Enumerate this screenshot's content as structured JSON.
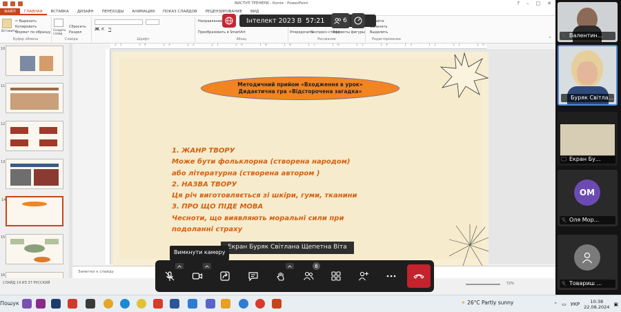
{
  "window": {
    "title": "ВИСТУП ТРЕНЕРИ - Копія - PowerPoint",
    "tabs": [
      "ФАЙЛ",
      "ГЛАВНАЯ",
      "ВСТАВКА",
      "ДИЗАЙН",
      "ПЕРЕХОДЫ",
      "АНИМАЦИЯ",
      "ПОКАЗ СЛАЙДОВ",
      "РЕЦЕНЗИРОВАНИЕ",
      "ВИД"
    ],
    "active_tab": "ГЛАВНАЯ",
    "accent": "#c8441a"
  },
  "ribbon": {
    "groups": [
      "Буфер обмена",
      "Слайды",
      "Шрифт",
      "Абзац",
      "Рисование",
      "Редактирование"
    ],
    "items": {
      "paste": "Вставить",
      "cut": "Вырезать",
      "copy": "Копировать",
      "format_painter": "Формат по образцу",
      "new_slide": "Создать слайд",
      "reset": "Сбросить",
      "section": "Раздел",
      "text_direction": "Направление текста",
      "smartart": "Преобразовать в SmartArt",
      "arrange": "Упорядочить",
      "express_styles": "Экспресс-стили",
      "shape_effects": "Эффекты фигуры",
      "find": "Найти",
      "replace": "Заменить",
      "select": "Выделить"
    }
  },
  "ruler": "25 · 24 · 23 · 22 · 21 · 20 · 19 · 18 · 17 · 16 · 15 · 14 · 13 · 12 · 11 · 10 · 9 · 8 · 7 · 6 · 5 · 4 · 3 · 2 · 1 · 0 · 1 · 2 · 3 · 4 · 5 · 6 · 7 · 8 · 9 · 10 · 11 · 12 · 13 · 14 · 15 · 16 · 17 · 18 · 19 · 20 · 21 · 22 · 23 · 24 · 25",
  "thumbnails": [
    "10",
    "11",
    "12",
    "13",
    "14",
    "15",
    "16"
  ],
  "selected_thumbnail": "14",
  "slide": {
    "title_line1": "Методичний прийом «Входження в урок»",
    "title_line2": "Дидактична гра «Відсторочена загадка»",
    "lines": [
      "1.    ЖАНР ТВОРУ",
      "Може бути фольклорна (створена народом)",
      "або літературна (створена автором )",
      "2. НАЗВА ТВОРУ",
      "Ця річ виготовляється зі шкіри, гуми, тканини",
      "3. ПРО ЩО ПІДЕ МОВА",
      "Чесноти, що виявляють моральні сили при",
      "подоланні страху"
    ]
  },
  "notes_placeholder": "Заметки к слайду",
  "statusbar": {
    "slide_info": "СЛАЙД 14 ИЗ 37",
    "language": "РУССКИЙ",
    "zoom": "72%"
  },
  "meeting": {
    "title": "Інтелект 2023 В",
    "timer": "57:21",
    "participants_count": "6",
    "share_label": "Екран Буряк Світлана Щепетна Віта",
    "tooltip": "Вимкнути камеру",
    "toolbar_badge": "6"
  },
  "participants": [
    {
      "name": "Валентин...",
      "type": "video"
    },
    {
      "name": "Буряк Світла...",
      "type": "video"
    },
    {
      "name": "Екран Бу...",
      "type": "screen"
    },
    {
      "name": "Оля Мор...",
      "type": "avatar",
      "initials": "ОМ",
      "color": "#6b4bb3"
    },
    {
      "name": "Товариш ...",
      "type": "avatar",
      "initials": "",
      "color": "#7a7a7a"
    }
  ],
  "taskbar": {
    "search": "Пошук",
    "weather": "26°C  Partly sunny",
    "language": "УКР",
    "time": "10:38",
    "date": "22.08.2024"
  }
}
